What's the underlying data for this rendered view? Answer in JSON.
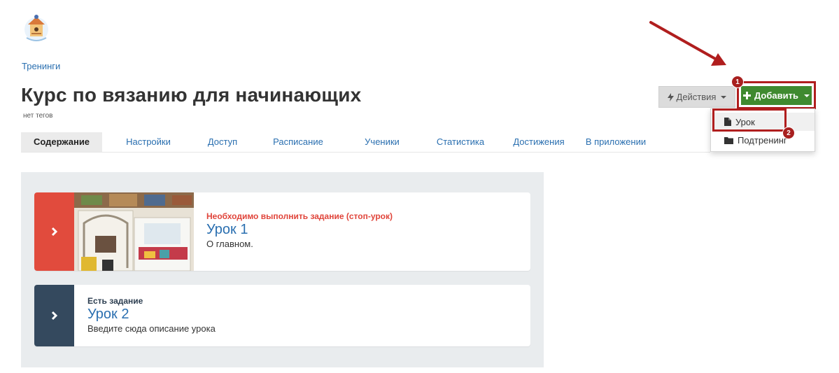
{
  "breadcrumb": "Тренинги",
  "page": {
    "title": "Курс по вязанию для начинающих",
    "tags": "нет тегов"
  },
  "tabs": [
    {
      "label": "Содержание",
      "active": true
    },
    {
      "label": "Настройки"
    },
    {
      "label": "Доступ"
    },
    {
      "label": "Расписание"
    },
    {
      "label": "Ученики"
    },
    {
      "label": "Статистика"
    },
    {
      "label": "Достижения"
    },
    {
      "label": "В приложении"
    }
  ],
  "toolbar": {
    "actions_label": "Действия",
    "add_label": "Добавить"
  },
  "add_menu": {
    "items": [
      {
        "label": "Урок",
        "icon": "file-icon"
      },
      {
        "label": "Подтренинг",
        "icon": "folder-icon"
      }
    ]
  },
  "annotations": {
    "badge_1": "1",
    "badge_2": "2"
  },
  "lessons": [
    {
      "status": "Необходимо выполнить задание (стоп-урок)",
      "status_color": "#e0443a",
      "side_color": "#e14b3d",
      "title": "Урок 1",
      "description": "О главном."
    },
    {
      "status": "Есть задание",
      "status_color": "#2c3e50",
      "side_color": "#34495e",
      "title": "Урок 2",
      "description": "Введите сюда описание урока"
    }
  ],
  "colors": {
    "link": "#2a6fb0",
    "add_button": "#3f8a2f",
    "highlight": "#b01e1e"
  }
}
